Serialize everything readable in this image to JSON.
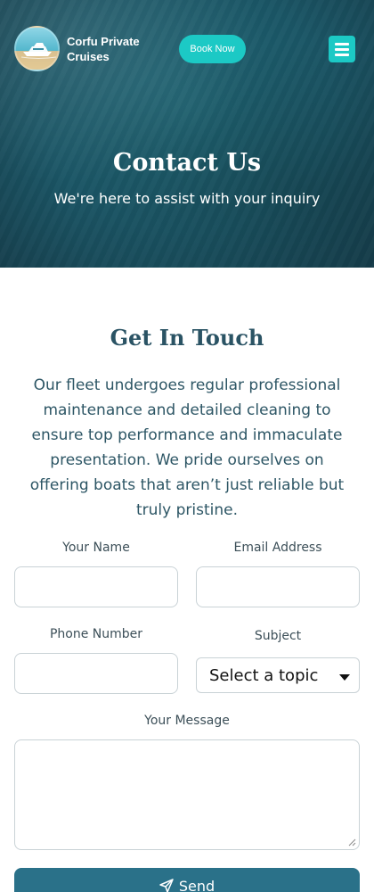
{
  "header": {
    "brand": "Corfu Private Cruises",
    "book_label": "Book Now",
    "logo_icon": "yacht-logo-icon",
    "menu_icon": "hamburger-menu-icon"
  },
  "hero": {
    "title": "Contact Us",
    "subtitle": "We're here to assist with your inquiry"
  },
  "contact": {
    "title": "Get In Touch",
    "intro": "Our fleet undergoes regular professional maintenance and detailed cleaning to ensure top performance and immaculate presentation. We pride ourselves on offering boats that aren’t just reliable but truly pristine."
  },
  "form": {
    "name_label": "Your Name",
    "name_value": "",
    "email_label": "Email Address",
    "email_value": "",
    "phone_label": "Phone Number",
    "phone_value": "",
    "subject_label": "Subject",
    "subject_selected": "Select a topic",
    "message_label": "Your Message",
    "message_value": "",
    "send_label": "Send",
    "send_icon": "paper-plane-icon"
  },
  "colors": {
    "accent": "#1cc9c5",
    "hero_bg": "#1a5565",
    "heading": "#2a5364",
    "button": "#2a7189"
  }
}
